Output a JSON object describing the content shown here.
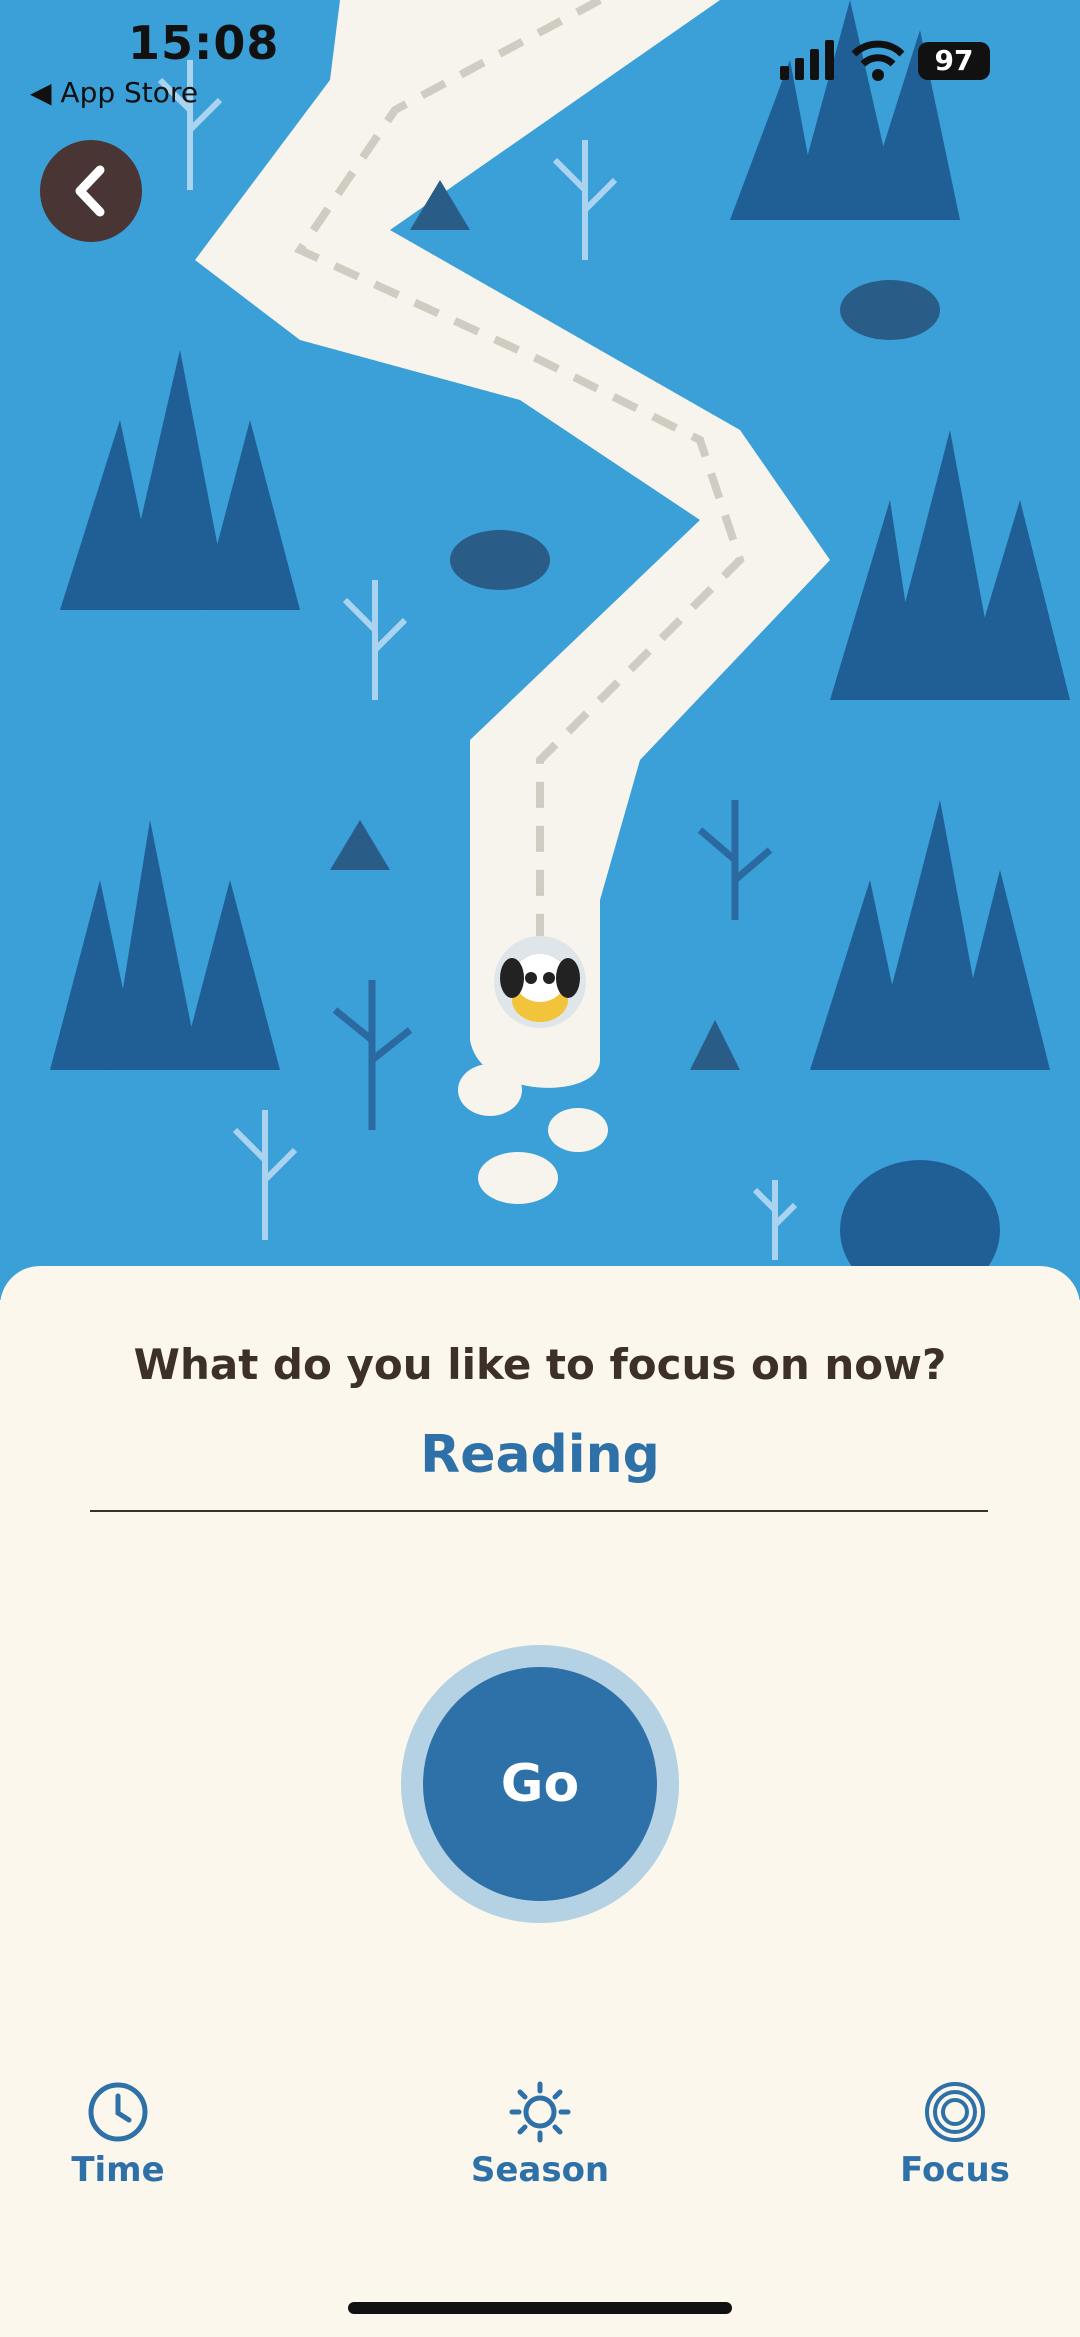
{
  "status_bar": {
    "time": "15:08",
    "back_app": "◀ App Store",
    "battery": "97"
  },
  "scene": {
    "icons": [
      "back-chevron-icon",
      "dog-avatar-icon"
    ],
    "colors": {
      "sky": "#3b9fd8",
      "tree": "#1f5f96",
      "path": "#f6f4ec"
    }
  },
  "focus": {
    "question": "What do you like to focus on now?",
    "value": "Reading"
  },
  "go_button": {
    "label": "Go"
  },
  "tabs": [
    {
      "label": "Time",
      "icon": "clock-icon"
    },
    {
      "label": "Season",
      "icon": "sun-icon"
    },
    {
      "label": "Focus",
      "icon": "target-icon"
    }
  ],
  "colors": {
    "accent": "#2e70a8",
    "sheet": "#fbf7ec",
    "text": "#3d302b"
  }
}
